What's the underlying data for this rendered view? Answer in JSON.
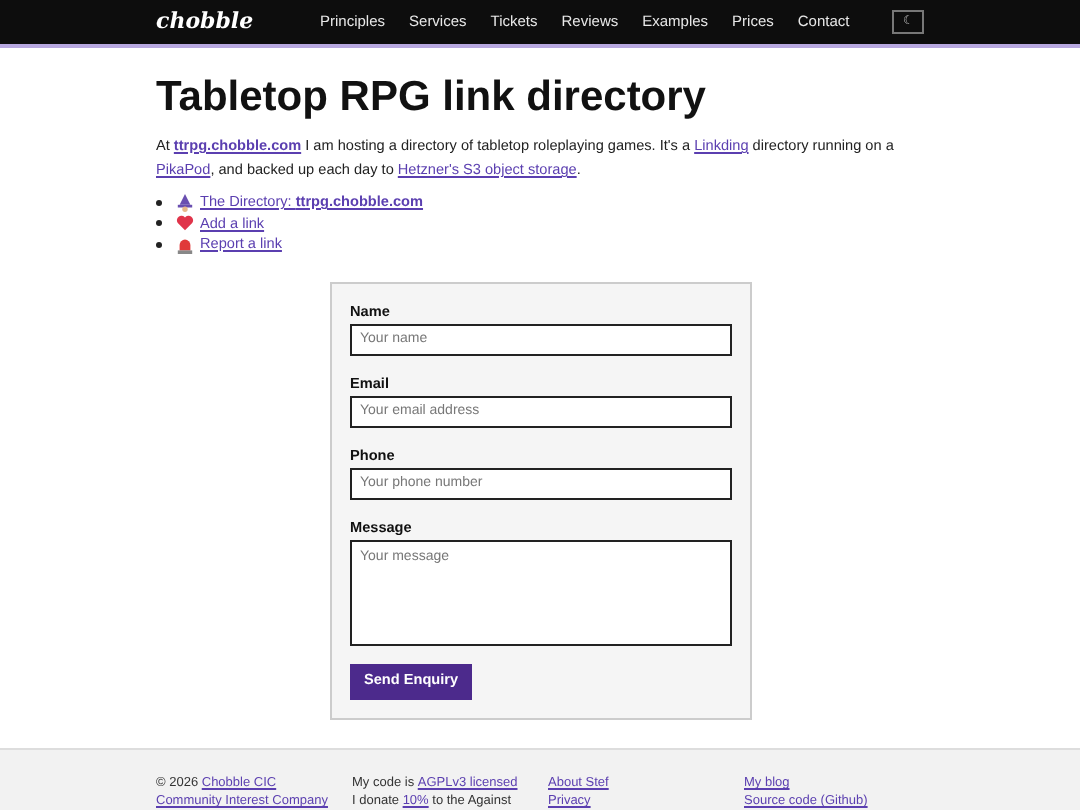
{
  "nav": {
    "logo": "chobble",
    "links": [
      "Principles",
      "Services",
      "Tickets",
      "Reviews",
      "Examples",
      "Prices",
      "Contact"
    ],
    "theme_toggle": "☾"
  },
  "title": "Tabletop RPG link directory",
  "intro_start": "At ",
  "intro_link0": "ttrpg.chobble.com",
  "intro": " I am hosting a directory of tabletop roleplaying games. It's a ",
  "intro_link1": "Linkding",
  "intro_mid": " directory running on a ",
  "intro_link2": "PikaPod",
  "intro_mid2": ", and backed up each day to ",
  "intro_link3": "Hetzner's S3 object storage",
  "intro_end": ".",
  "links": [
    {
      "kind": "wizard",
      "text": "The Directory: **ttrpg.chobble.com**"
    },
    {
      "kind": "heart",
      "text": "Add a link"
    },
    {
      "kind": "siren",
      "text": "Report a link"
    }
  ],
  "form": {
    "fields": [
      {
        "kind": "input",
        "label": "Name",
        "placeholder": "Your name"
      },
      {
        "kind": "input",
        "label": "Email",
        "placeholder": "Your email address"
      },
      {
        "kind": "input",
        "label": "Phone",
        "placeholder": "Your phone number"
      },
      {
        "kind": "textarea",
        "label": "Message",
        "placeholder": "Your message"
      }
    ],
    "submit": "Send Enquiry"
  },
  "footer": {
    "columns": [
      [
        {
          "prefix": "© 2026 ",
          "link": "Chobble CIC"
        },
        {
          "link": "Community Interest Company"
        }
      ],
      [
        {
          "prefix": "My code is ",
          "link": "AGPLv3 licensed"
        },
        {
          "prefix": "I donate ",
          "link": "10%",
          "suffix": " to the Against"
        }
      ],
      [
        {
          "link": "About Stef"
        },
        {
          "link": "Privacy"
        }
      ],
      [
        {
          "link": "My blog"
        },
        {
          "link": "Source code (Github)"
        }
      ]
    ]
  }
}
